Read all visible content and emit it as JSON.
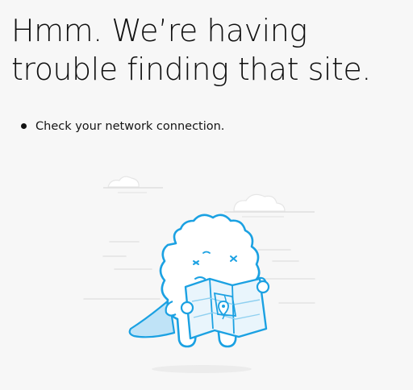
{
  "page": {
    "title": "Hmm. We’re having trouble finding that site.",
    "background": "#f7f7f7",
    "accent": "#1ba1e2"
  },
  "tips": [
    {
      "text": "Check your network connection."
    }
  ],
  "illustration": {
    "icon": "lost-creature-with-map-illustration",
    "elements": [
      "cloud-icon",
      "cloud-icon",
      "confused-creature",
      "map-icon",
      "location-pin-icon"
    ]
  }
}
